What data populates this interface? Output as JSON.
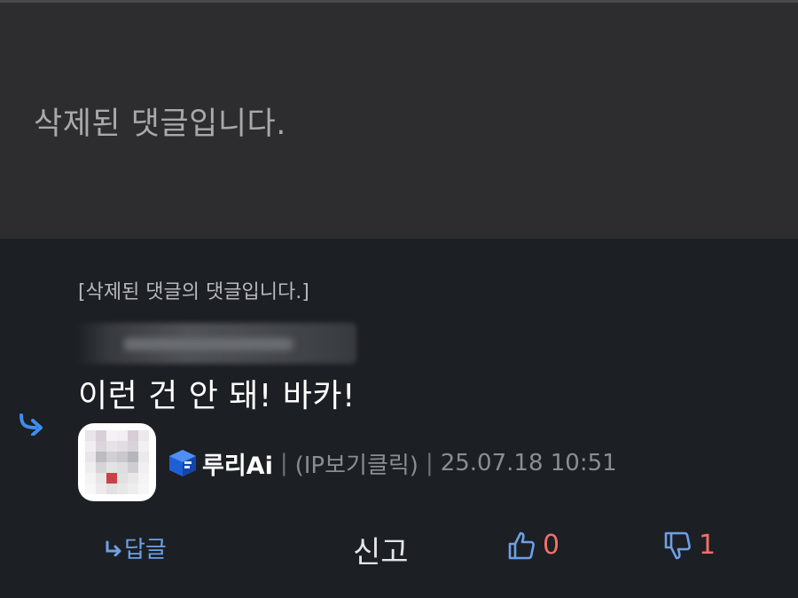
{
  "parent_comment": {
    "deleted_text": "삭제된 댓글입니다."
  },
  "reply": {
    "parent_reference": "[삭제된 댓글의 댓글입니다.]",
    "text": "이런 건 안 돼! 바카!",
    "author": {
      "nickname": "루리Ai",
      "separator": "|",
      "ip_label": "(IP보기클릭)",
      "datetime": "25.07.18 10:51"
    },
    "actions": {
      "reply_label": "답글",
      "report_label": "신고",
      "upvotes": "0",
      "downvotes": "1"
    }
  },
  "colors": {
    "deleted_bg": "#2d2d2f",
    "page_bg": "#1c1f24",
    "accent_blue": "#3d8ef0",
    "vote_red": "#f1706a",
    "thumb_blue": "#6ea0e6"
  },
  "icons": [
    "reply-arrow-icon",
    "level-cube-icon",
    "thumbs-up-icon",
    "thumbs-down-icon"
  ]
}
